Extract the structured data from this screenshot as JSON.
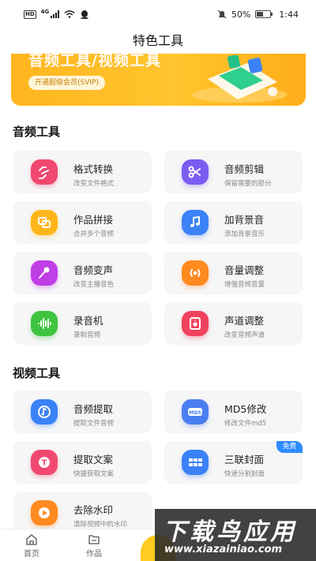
{
  "status_bar": {
    "hd": "HD",
    "net": "4G",
    "battery_text": "50%",
    "battery_level": 0.5,
    "time": "1:44"
  },
  "page_title": "特色工具",
  "banner": {
    "title": "音频工具/视频工具",
    "pill": "开通超级会员(SVIP)"
  },
  "audio_section": {
    "title": "音频工具",
    "items": [
      {
        "name": "格式转换",
        "desc": "改变文件格式",
        "icon": "convert-icon",
        "color": "#f0486f"
      },
      {
        "name": "音频剪辑",
        "desc": "保留需要的部分",
        "icon": "scissors-icon",
        "color": "#7b5cf0"
      },
      {
        "name": "作品拼接",
        "desc": "合并多个音频",
        "icon": "merge-icon",
        "color": "#ffb61a"
      },
      {
        "name": "加背景音",
        "desc": "添加背景音乐",
        "icon": "music-note-icon",
        "color": "#3b82f6"
      },
      {
        "name": "音频变声",
        "desc": "改变主播音色",
        "icon": "microphone-icon",
        "color": "#c03ee6"
      },
      {
        "name": "音量调整",
        "desc": "增强音频音量",
        "icon": "volume-icon",
        "color": "#ff8a1f"
      },
      {
        "name": "录音机",
        "desc": "录制音频",
        "icon": "waveform-icon",
        "color": "#3fc43f"
      },
      {
        "name": "声道调整",
        "desc": "改变音频声道",
        "icon": "speaker-icon",
        "color": "#f0425e"
      }
    ]
  },
  "video_section": {
    "title": "视频工具",
    "items": [
      {
        "name": "音频提取",
        "desc": "提取文件音频",
        "icon": "music-extract-icon",
        "color": "#3b82f6"
      },
      {
        "name": "MD5修改",
        "desc": "修改文件md5",
        "icon": "md5-icon",
        "color": "#4a7ef0",
        "badge_text": "MD5"
      },
      {
        "name": "提取文案",
        "desc": "快捷获取文案",
        "icon": "text-extract-icon",
        "color": "#f0486f",
        "badge_text": "T"
      },
      {
        "name": "三联封面",
        "desc": "快速分割封面",
        "icon": "grid-icon",
        "color": "#3b82f6",
        "badge": "免费"
      },
      {
        "name": "去除水印",
        "desc": "清除视频中的水印",
        "icon": "play-icon",
        "color": "#ff8a1f"
      }
    ]
  },
  "bottom_nav": {
    "items": [
      {
        "label": "首页",
        "icon": "home-icon"
      },
      {
        "label": "作品",
        "icon": "folder-icon"
      }
    ]
  },
  "watermark": {
    "big": "下载鸟应用",
    "small": "www.xiazainiao.com"
  }
}
